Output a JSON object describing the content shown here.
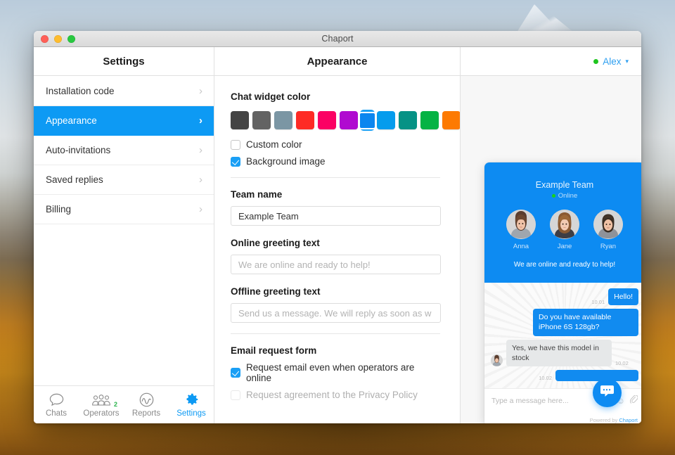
{
  "desktop": {
    "wallpaper_name": "macos-sierra-mountain-wallpaper"
  },
  "window": {
    "title": "Chaport",
    "traffic_lights": [
      "close-red",
      "minimize-yellow",
      "maximize-green"
    ]
  },
  "sidebar": {
    "header": "Settings",
    "items": [
      {
        "label": "Installation code",
        "active": false,
        "chevron": "›"
      },
      {
        "label": "Appearance",
        "active": true,
        "chevron": "›"
      },
      {
        "label": "Auto-invitations",
        "active": false,
        "chevron": "›"
      },
      {
        "label": "Saved replies",
        "active": false,
        "chevron": "›"
      },
      {
        "label": "Billing",
        "active": false,
        "chevron": "›"
      }
    ],
    "accent_color": "#0d9af4"
  },
  "bottom_nav": {
    "items": [
      {
        "label": "Chats",
        "icon": "speech-bubble-icon",
        "active": false,
        "badge": ""
      },
      {
        "label": "Operators",
        "icon": "operators-group-icon",
        "active": false,
        "badge": "2"
      },
      {
        "label": "Reports",
        "icon": "wave-chart-circle-icon",
        "active": false,
        "badge": ""
      },
      {
        "label": "Settings",
        "icon": "gear-icon",
        "active": true,
        "badge": ""
      }
    ],
    "badge_color": "#28b34b",
    "active_color": "#0d9af4"
  },
  "main": {
    "header": "Appearance",
    "widget_color": {
      "title": "Chat widget color",
      "swatches": [
        {
          "hex": "#444444",
          "selected": false
        },
        {
          "hex": "#636363",
          "selected": false
        },
        {
          "hex": "#7b96a4",
          "selected": false
        },
        {
          "hex": "#fe2b25",
          "selected": false
        },
        {
          "hex": "#fb0164",
          "selected": false
        },
        {
          "hex": "#b00ad0",
          "selected": false
        },
        {
          "hex": "#0b86ef",
          "selected": true
        },
        {
          "hex": "#059ced",
          "selected": false
        },
        {
          "hex": "#069285",
          "selected": false
        },
        {
          "hex": "#05b344",
          "selected": false
        },
        {
          "hex": "#fd7a02",
          "selected": false
        }
      ],
      "selection_ring_color": "#1aa0f5",
      "checkboxes": [
        {
          "label": "Custom color",
          "checked": false
        },
        {
          "label": "Background image",
          "checked": true
        }
      ]
    },
    "team_name": {
      "label": "Team name",
      "value": "Example Team",
      "placeholder": ""
    },
    "online_greeting": {
      "label": "Online greeting text",
      "value": "",
      "placeholder": "We are online and ready to help!"
    },
    "offline_greeting": {
      "label": "Offline greeting text",
      "value": "",
      "placeholder": "Send us a message. We will reply as soon as w"
    },
    "email_request": {
      "title": "Email request form",
      "checkboxes": [
        {
          "label": "Request email even when operators are online",
          "checked": true
        },
        {
          "label": "Request agreement to the Privacy Policy",
          "checked": false
        }
      ]
    }
  },
  "account": {
    "name": "Alex",
    "status": "online",
    "chevron": "∨",
    "link_color": "#2e9ff0",
    "status_color": "#1ec51e"
  },
  "widget_preview": {
    "team_name": "Example Team",
    "status_text": "Online",
    "greeting": "We are online and ready to help!",
    "header_color": "#0d8bf2",
    "operators": [
      {
        "name": "Anna",
        "avatar": "avatar-anna"
      },
      {
        "name": "Jane",
        "avatar": "avatar-jane"
      },
      {
        "name": "Ryan",
        "avatar": "avatar-ryan"
      }
    ],
    "messages": [
      {
        "from": "visitor",
        "text": "Hello!",
        "time": "10.01"
      },
      {
        "from": "visitor",
        "text": "Do you have available iPhone 6S 128gb?",
        "time": ""
      },
      {
        "from": "operator",
        "text": "Yes, we have this model in stock",
        "time": "10.02",
        "avatar": "avatar-anna"
      },
      {
        "from": "visitor",
        "text": "",
        "time": "10.02",
        "clipped": true
      }
    ],
    "composer_placeholder": "Type a message here...",
    "composer_icons": [
      "emoji-smiley-icon",
      "paperclip-attach-icon"
    ],
    "powered_by_prefix": "Powered by ",
    "powered_by_brand": "Chaport",
    "launcher_icon": "chat-bubble-dots-icon"
  }
}
